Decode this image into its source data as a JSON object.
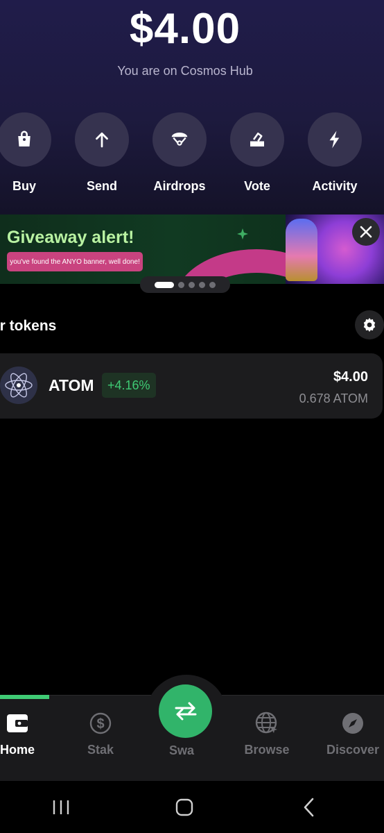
{
  "header": {
    "balance": "$4.00",
    "network_text": "You are on Cosmos Hub"
  },
  "actions": [
    {
      "label": "Buy",
      "icon": "shopping-bag-icon"
    },
    {
      "label": "Send",
      "icon": "arrow-up-icon"
    },
    {
      "label": "Airdrops",
      "icon": "parachute-icon"
    },
    {
      "label": "Vote",
      "icon": "ballot-box-icon"
    },
    {
      "label": "Activity",
      "icon": "lightning-icon"
    }
  ],
  "banner": {
    "title": "Giveaway alert!",
    "subtitle": "you've found the ANYO banner, well done!",
    "active_slide": 1,
    "slide_count": 5
  },
  "tokens": {
    "title": "our tokens",
    "items": [
      {
        "symbol": "ATOM",
        "change": "+4.16%",
        "value": "$4.00",
        "amount": "0.678 ATOM"
      }
    ]
  },
  "bottom_nav": {
    "items": [
      {
        "label": "Home",
        "icon": "wallet-icon"
      },
      {
        "label": "Stak",
        "icon": "dollar-circle-icon"
      },
      {
        "label": "Swa",
        "icon": "swap-arrows-icon"
      },
      {
        "label": "Browse",
        "icon": "globe-icon"
      },
      {
        "label": "Discover",
        "icon": "compass-icon"
      }
    ]
  },
  "colors": {
    "accent_green": "#31b46a",
    "positive_change": "#3fca74",
    "hero_bg": "#201c4a"
  }
}
